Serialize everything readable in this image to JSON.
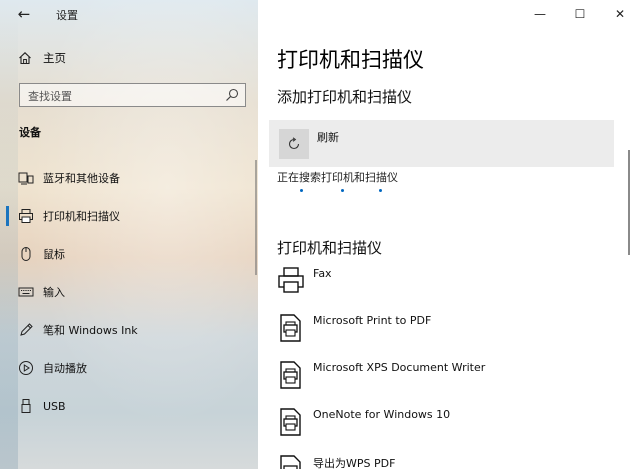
{
  "window": {
    "title": "设置",
    "minimize": "—",
    "maximize": "☐",
    "close": "✕"
  },
  "sidebar": {
    "back_icon": "←",
    "home_label": "主页",
    "search_placeholder": "查找设置",
    "section_label": "设备",
    "items": [
      {
        "label": "蓝牙和其他设备",
        "icon": "bluetooth-devices-icon",
        "selected": false
      },
      {
        "label": "打印机和扫描仪",
        "icon": "printer-icon",
        "selected": true
      },
      {
        "label": "鼠标",
        "icon": "mouse-icon",
        "selected": false
      },
      {
        "label": "输入",
        "icon": "keyboard-icon",
        "selected": false
      },
      {
        "label": "笔和 Windows Ink",
        "icon": "pen-icon",
        "selected": false
      },
      {
        "label": "自动播放",
        "icon": "autoplay-icon",
        "selected": false
      },
      {
        "label": "USB",
        "icon": "usb-icon",
        "selected": false
      }
    ]
  },
  "main": {
    "page_title": "打印机和扫描仪",
    "add_section_title": "添加打印机和扫描仪",
    "refresh_label": "刷新",
    "searching_text": "正在搜索打印机和扫描仪",
    "list_section_title": "打印机和扫描仪",
    "printers": [
      {
        "name": "Fax",
        "icon": "fax-printer-icon"
      },
      {
        "name": "Microsoft Print to PDF",
        "icon": "document-printer-icon"
      },
      {
        "name": "Microsoft XPS Document Writer",
        "icon": "document-printer-icon"
      },
      {
        "name": "OneNote for Windows 10",
        "icon": "document-printer-icon"
      },
      {
        "name": "导出为WPS PDF",
        "icon": "document-printer-icon"
      }
    ]
  },
  "colors": {
    "accent": "#0067c0",
    "refresh_bg": "#ececec"
  }
}
